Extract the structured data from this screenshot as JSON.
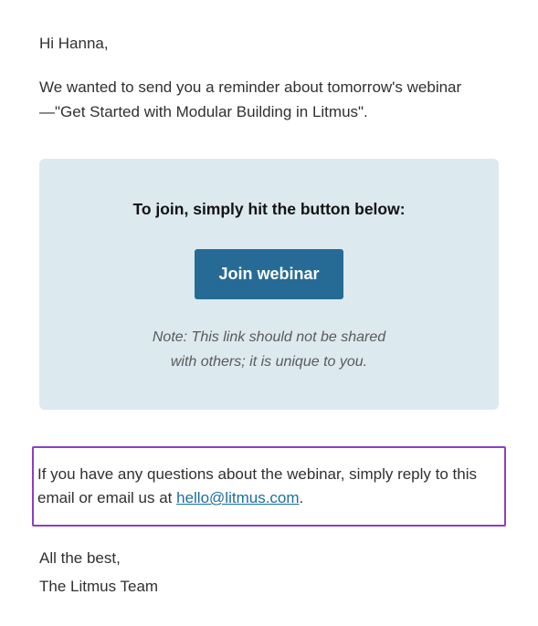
{
  "greeting": "Hi Hanna,",
  "reminder": "We wanted to send you a reminder about tomorrow's webinar—\"Get Started with Modular Building in Litmus\".",
  "callout": {
    "title": "To join, simply hit the button below:",
    "button_label": "Join webinar",
    "note_line1": "Note: This link should not be shared",
    "note_line2": "with others; it is unique to you."
  },
  "questions": {
    "before": "If you have any questions about the webinar, simply reply to this email or email us at ",
    "email": "hello@litmus.com",
    "after": "."
  },
  "signoff": "All the best,",
  "team": "The Litmus Team"
}
